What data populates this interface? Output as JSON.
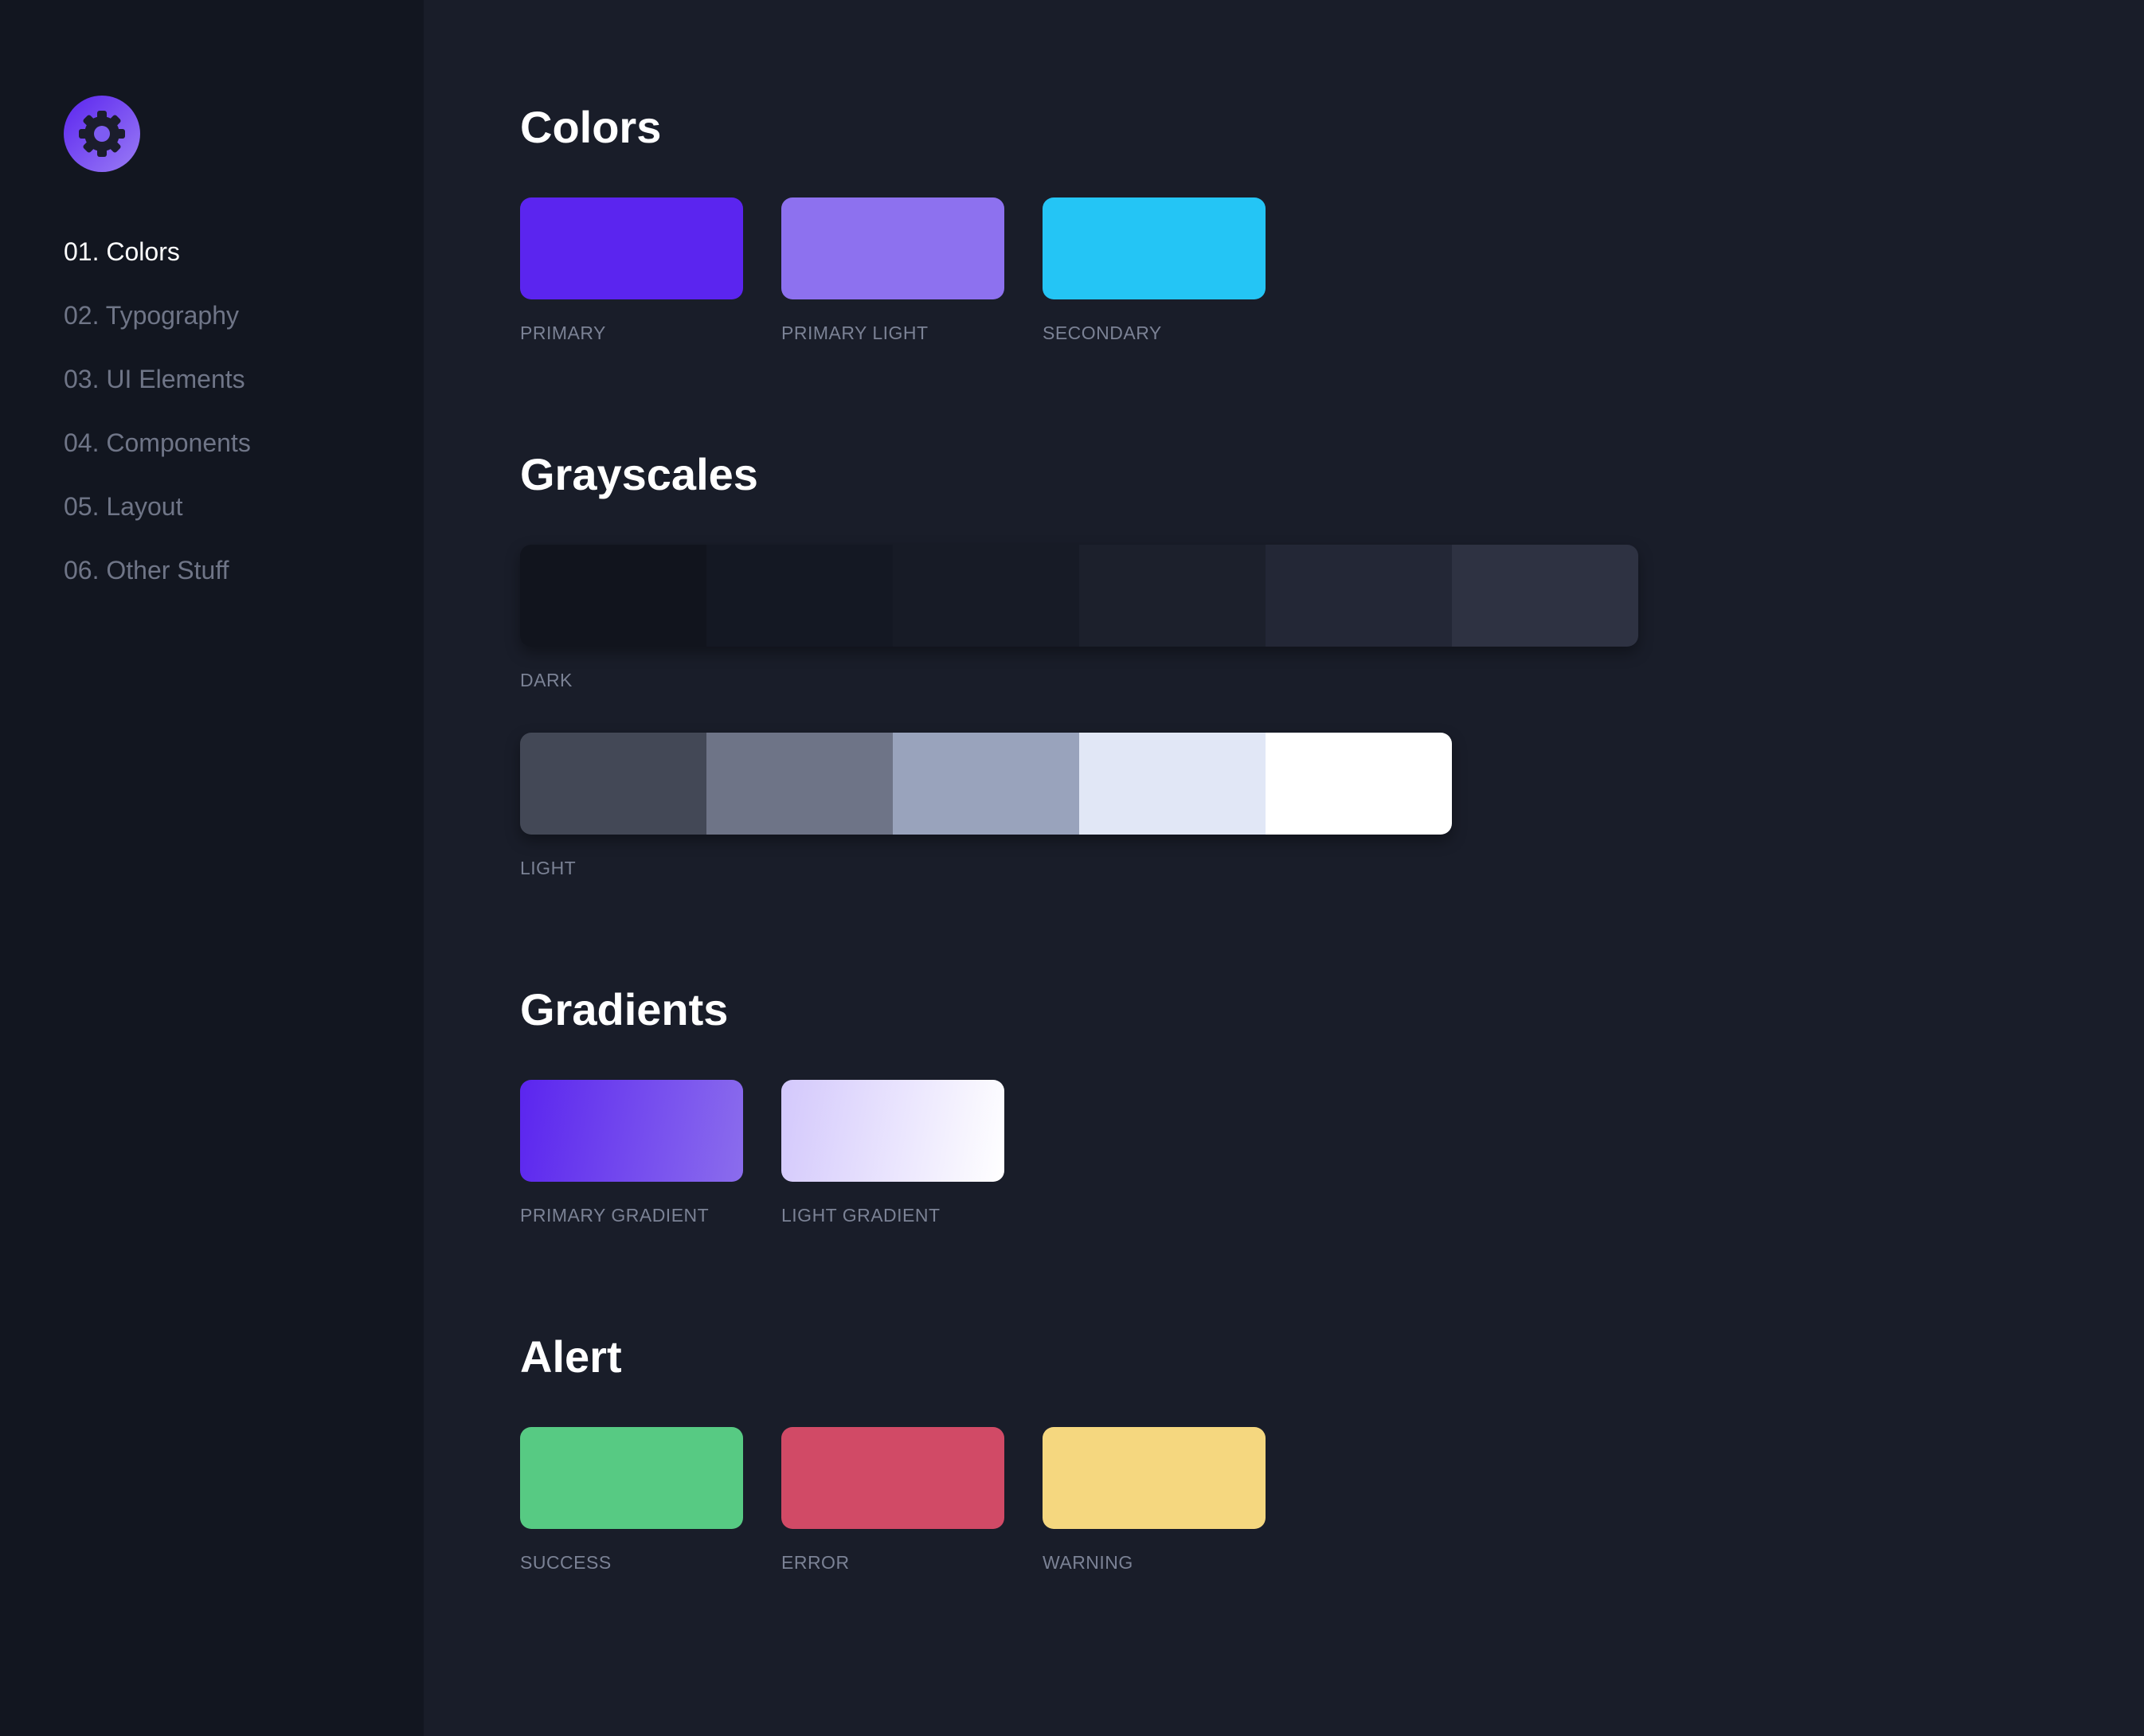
{
  "sidebar": {
    "logo_icon": "gear-icon",
    "items": [
      {
        "label": "01. Colors",
        "active": true
      },
      {
        "label": "02. Typography",
        "active": false
      },
      {
        "label": "03. UI Elements",
        "active": false
      },
      {
        "label": "04. Components",
        "active": false
      },
      {
        "label": "05. Layout",
        "active": false
      },
      {
        "label": "06. Other Stuff",
        "active": false
      }
    ]
  },
  "colors": {
    "title": "Colors",
    "swatches": [
      {
        "label": "PRIMARY",
        "color": "#5b25ef"
      },
      {
        "label": "PRIMARY LIGHT",
        "color": "#8d71ef"
      },
      {
        "label": "SECONDARY",
        "color": "#24c5f5"
      }
    ]
  },
  "grayscales": {
    "title": "Grayscales",
    "dark": {
      "label": "DARK",
      "colors": [
        "#11141d",
        "#141823",
        "#171b26",
        "#1c202c",
        "#232736",
        "#2e3242"
      ]
    },
    "light": {
      "label": "LIGHT",
      "colors": [
        "#434856",
        "#6e7487",
        "#99a3bc",
        "#e1e7f6",
        "#ffffff"
      ]
    }
  },
  "gradients": {
    "title": "Gradients",
    "swatches": [
      {
        "label": "PRIMARY GRADIENT",
        "from": "#5b25ef",
        "to": "#8b6ded"
      },
      {
        "label": "LIGHT GRADIENT",
        "from": "#d3c8fc",
        "to": "#ffffff"
      }
    ]
  },
  "alert": {
    "title": "Alert",
    "swatches": [
      {
        "label": "SUCCESS",
        "color": "#57ca83"
      },
      {
        "label": "ERROR",
        "color": "#d14a66"
      },
      {
        "label": "WARNING",
        "color": "#f5d77f"
      }
    ]
  },
  "theme": {
    "background": "#191d29",
    "sidebar_background": "#121620",
    "nav_active_color": "#ffffff",
    "nav_inactive_color": "#6f7587",
    "label_color": "#7b8295"
  }
}
